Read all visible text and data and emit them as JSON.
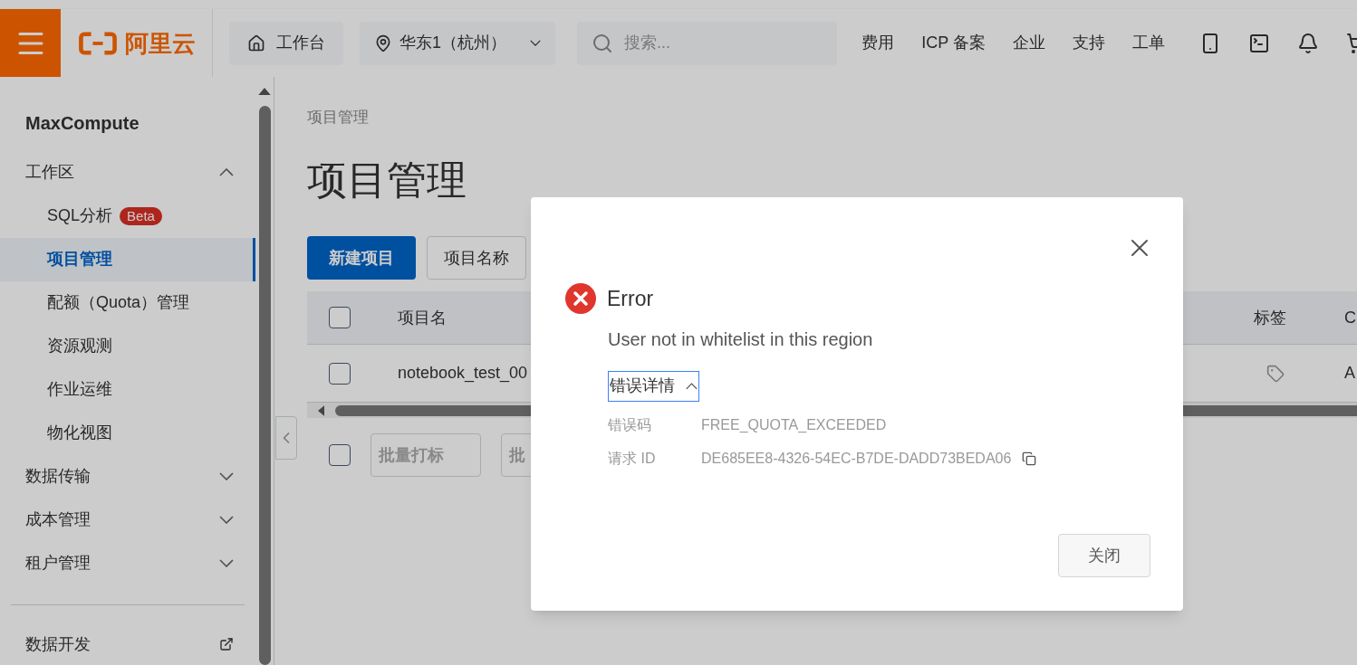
{
  "top_bar": {
    "logo": "阿里云",
    "workbench": "工作台",
    "region": "华东1（杭州）",
    "search": {
      "placeholder": "搜索..."
    },
    "links": [
      "费用",
      "ICP 备案",
      "企业",
      "支持",
      "工单"
    ]
  },
  "sidebar": {
    "title": "MaxCompute",
    "items": [
      {
        "label": "工作区",
        "expanded": true,
        "children": [
          {
            "label": "SQL分析",
            "badge": "Beta",
            "selected": false
          },
          {
            "label": "项目管理",
            "selected": true
          },
          {
            "label": "配额（Quota）管理",
            "selected": false
          },
          {
            "label": "资源观测",
            "selected": false
          },
          {
            "label": "作业运维",
            "selected": false
          },
          {
            "label": "物化视图",
            "selected": false
          }
        ]
      },
      {
        "label": "数据传输",
        "expanded": false
      },
      {
        "label": "成本管理",
        "expanded": false
      },
      {
        "label": "租户管理",
        "expanded": false
      }
    ],
    "footer_link": "数据开发"
  },
  "breadcrumb": "项目管理",
  "page_title": "项目管理",
  "toolbar": {
    "create_button": "新建项目",
    "filter_select": "项目名称"
  },
  "table": {
    "header_checked": false,
    "columns": [
      "项目名",
      "标签",
      "C"
    ],
    "rows": [
      {
        "checked": false,
        "name": "notebook_test_00",
        "column_3": "A"
      }
    ]
  },
  "batch_bar": {
    "checked": false,
    "buttons": [
      "批量打标",
      "批"
    ]
  },
  "dialog": {
    "title": "Error",
    "message": "User not in whitelist in this region",
    "details_toggle": {
      "label": "错误详情",
      "expanded": true
    },
    "details": [
      {
        "label": "错误码",
        "value": "FREE_QUOTA_EXCEEDED",
        "copyable": false
      },
      {
        "label": "请求 ID",
        "value": "DE685EE8-4326-54EC-B7DE-DADD73BEDA06",
        "copyable": true
      }
    ],
    "close_button": "关闭"
  }
}
